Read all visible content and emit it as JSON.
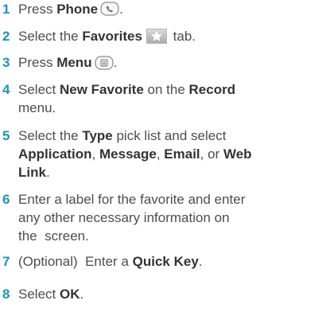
{
  "steps": [
    {
      "number": "1",
      "lines": [
        {
          "parts": [
            {
              "t": "Press ",
              "b": false
            },
            {
              "t": "Phone",
              "b": true
            },
            {
              "icon": "phone-icon"
            },
            {
              "t": ".",
              "b": false
            }
          ]
        }
      ]
    },
    {
      "number": "2",
      "lines": [
        {
          "parts": [
            {
              "t": "Select the ",
              "b": false
            },
            {
              "t": "Favorites",
              "b": true
            },
            {
              "icon": "favorites-star-icon"
            },
            {
              "t": " tab.",
              "b": false
            }
          ]
        }
      ]
    },
    {
      "number": "3",
      "lines": [
        {
          "parts": [
            {
              "t": "Press ",
              "b": false
            },
            {
              "t": "Menu",
              "b": true
            },
            {
              "icon": "menu-icon"
            },
            {
              "t": ".",
              "b": false
            }
          ]
        }
      ]
    },
    {
      "number": "4",
      "lines": [
        {
          "parts": [
            {
              "t": "Select ",
              "b": false
            },
            {
              "t": "New Favorite",
              "b": true
            },
            {
              "t": " on the ",
              "b": false
            },
            {
              "t": "Record",
              "b": true
            }
          ]
        },
        {
          "parts": [
            {
              "t": "menu.",
              "b": false
            }
          ]
        }
      ]
    },
    {
      "number": "5",
      "lines": [
        {
          "parts": [
            {
              "t": "Select the ",
              "b": false
            },
            {
              "t": "Type",
              "b": true
            },
            {
              "t": " pick list and select",
              "b": false
            }
          ]
        },
        {
          "parts": [
            {
              "t": "Application",
              "b": true
            },
            {
              "t": ", ",
              "b": false
            },
            {
              "t": "Message",
              "b": true
            },
            {
              "t": ", ",
              "b": false
            },
            {
              "t": "Email",
              "b": true
            },
            {
              "t": ", or ",
              "b": false
            },
            {
              "t": "Web",
              "b": true
            }
          ]
        },
        {
          "parts": [
            {
              "t": "Link",
              "b": true
            },
            {
              "t": ".",
              "b": false
            }
          ]
        }
      ]
    },
    {
      "number": "6",
      "lines": [
        {
          "parts": [
            {
              "t": "Enter a label for the favorite and enter",
              "b": false
            }
          ]
        },
        {
          "parts": [
            {
              "t": "any other necessary information on",
              "b": false
            }
          ]
        },
        {
          "parts": [
            {
              "t": "the  screen.",
              "b": false
            }
          ]
        }
      ]
    },
    {
      "number": "7",
      "lines": [
        {
          "parts": [
            {
              "t": "(Optional)  Enter a ",
              "b": false
            },
            {
              "t": "Quick Key",
              "b": true
            },
            {
              "t": ".",
              "b": false
            }
          ]
        }
      ]
    },
    {
      "number": "8",
      "lines": [
        {
          "parts": [
            {
              "t": "Select ",
              "b": false
            },
            {
              "t": "OK",
              "b": true
            },
            {
              "t": ".",
              "b": false
            }
          ]
        }
      ]
    }
  ],
  "colors": {
    "step_number": "#1a93c9",
    "body_text": "#4d4d4d",
    "bold_text": "#333333"
  }
}
